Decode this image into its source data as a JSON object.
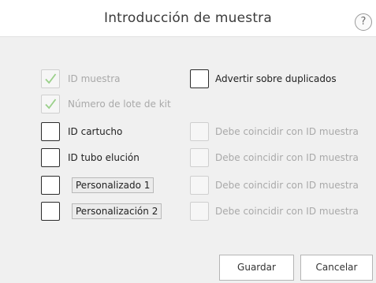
{
  "dialog": {
    "title": "Introducción de muestra",
    "help_label": "?"
  },
  "left_options": [
    {
      "label": "ID muestra",
      "checked": true,
      "enabled": false
    },
    {
      "label": "Número de lote de kit",
      "checked": true,
      "enabled": false
    },
    {
      "label": "ID cartucho",
      "checked": false,
      "enabled": true
    },
    {
      "label": "ID tubo elución",
      "checked": false,
      "enabled": true
    },
    {
      "label": "Personalizado 1",
      "checked": false,
      "enabled": true
    },
    {
      "label": "Personalización 2",
      "checked": false,
      "enabled": true
    }
  ],
  "right_options": [
    {
      "label": "Advertir sobre duplicados",
      "checked": false,
      "enabled": true
    },
    {
      "label": "Debe coincidir con ID muestra",
      "checked": false,
      "enabled": false
    },
    {
      "label": "Debe coincidir con ID muestra",
      "checked": false,
      "enabled": false
    },
    {
      "label": "Debe coincidir con ID muestra",
      "checked": false,
      "enabled": false
    },
    {
      "label": "Debe coincidir con ID muestra",
      "checked": false,
      "enabled": false
    }
  ],
  "buttons": {
    "save": "Guardar",
    "cancel": "Cancelar"
  },
  "colors": {
    "check_mark": "#9ad08a",
    "dialog_bg": "#f0f0f0",
    "disabled_text": "#a9a9a9"
  }
}
